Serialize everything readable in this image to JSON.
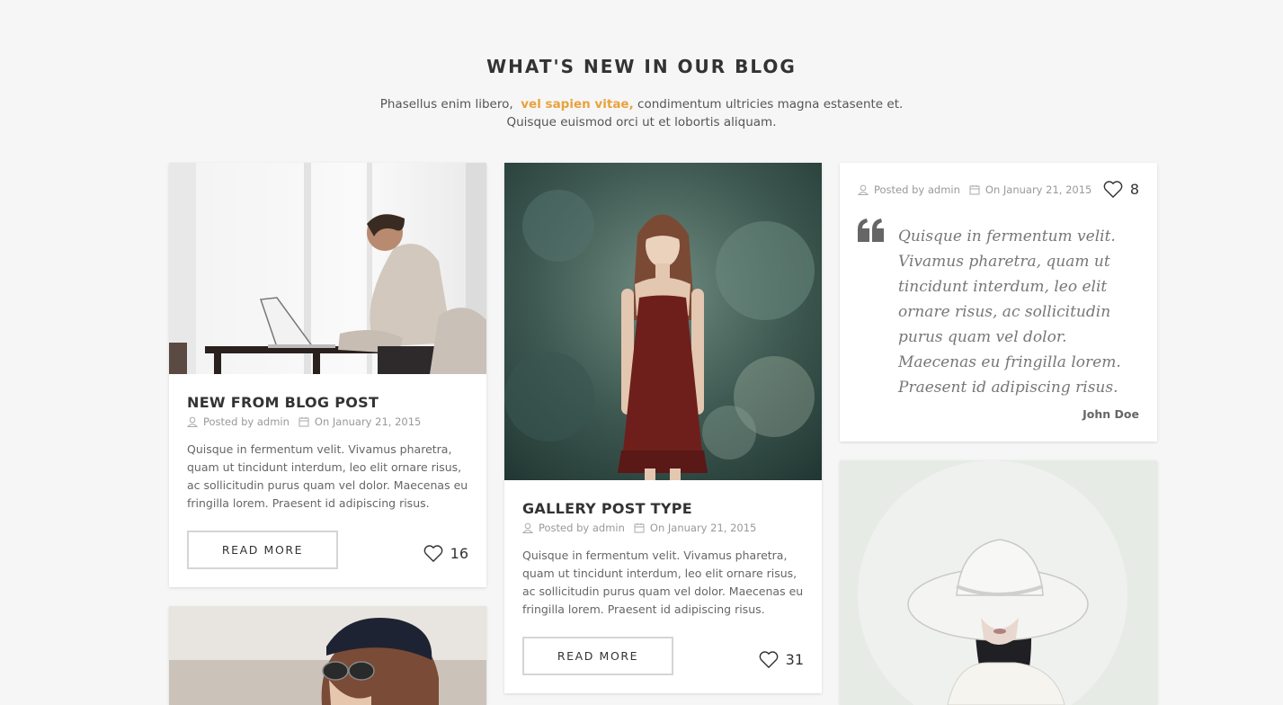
{
  "section": {
    "title": "WHAT'S NEW IN OUR BLOG",
    "subtitle_before": "Phasellus enim libero,",
    "subtitle_highlight": "vel sapien vitae,",
    "subtitle_after": "condimentum ultricies magna estasente et.",
    "subtitle_line2": "Quisque euismod orci ut et lobortis aliquam."
  },
  "colors": {
    "accent": "#e9a23b",
    "background": "#f6f6f6"
  },
  "posts": [
    {
      "title": "NEW FROM BLOG POST",
      "author": "Posted by admin",
      "date": "On January 21, 2015",
      "excerpt": "Quisque in fermentum velit. Vivamus pharetra, quam ut tincidunt interdum, leo elit ornare risus, ac sollicitudin purus quam vel dolor. Maecenas eu fringilla lorem. Praesent id adipiscing risus.",
      "button": "READ MORE",
      "likes": "16"
    },
    {
      "title": "GALLERY POST TYPE",
      "author": "Posted by admin",
      "date": "On January 21, 2015",
      "excerpt": "Quisque in fermentum velit. Vivamus pharetra, quam ut tincidunt interdum, leo elit ornare risus, ac sollicitudin purus quam vel dolor. Maecenas eu fringilla lorem. Praesent id adipiscing risus.",
      "button": "READ MORE",
      "likes": "31"
    }
  ],
  "quote_post": {
    "author": "Posted by admin",
    "date": "On January 21, 2015",
    "likes": "8",
    "quote": "Quisque in fermentum velit. Vivamus pharetra, quam ut tincidunt interdum, leo elit ornare risus, ac sollicitudin purus quam vel dolor. Maecenas eu fringilla lorem. Praesent id adipiscing risus.",
    "quote_author": "John Doe"
  },
  "icons": {
    "author": "user-icon",
    "date": "calendar-icon",
    "likes": "heart-icon",
    "quote": "quote-icon"
  }
}
